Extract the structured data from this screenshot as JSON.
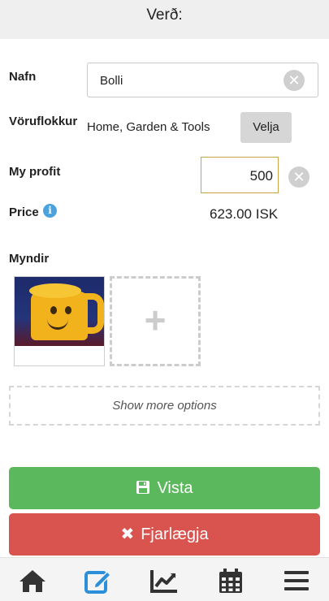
{
  "header": {
    "title": "Verð:"
  },
  "form": {
    "name_label": "Nafn",
    "name_value": "Bolli",
    "category_label": "Vöruflokkur",
    "category_value": "Home, Garden & Tools",
    "choose_label": "Velja",
    "profit_label": "My profit",
    "profit_value": "500",
    "price_label": "Price",
    "price_value": "623.00 ISK",
    "photos_label": "Myndir",
    "more_options_label": "Show more options",
    "save_label": "Vista",
    "remove_label": "Fjarlægja"
  },
  "colors": {
    "save": "#5cb85c",
    "remove": "#d9534f",
    "nav_active": "#2b8fd9",
    "nav_inactive": "#333333"
  },
  "bottom_nav": [
    {
      "icon": "home-icon",
      "active": false
    },
    {
      "icon": "edit-icon",
      "active": true
    },
    {
      "icon": "chart-icon",
      "active": false
    },
    {
      "icon": "calendar-icon",
      "active": false
    },
    {
      "icon": "menu-icon",
      "active": false
    }
  ]
}
